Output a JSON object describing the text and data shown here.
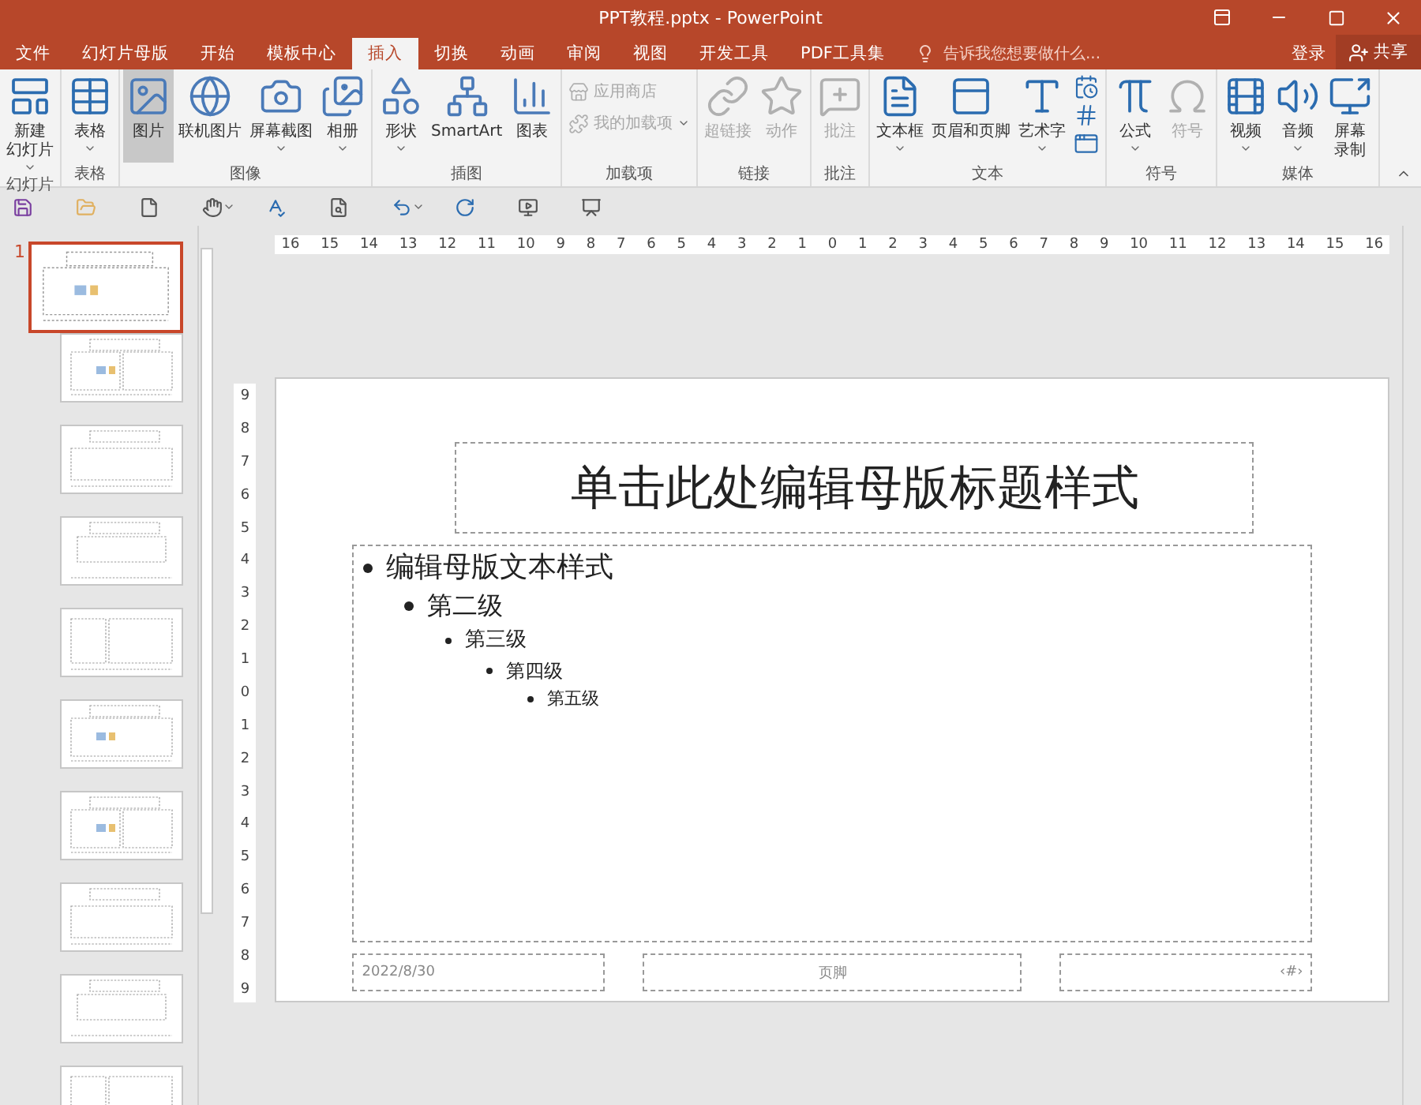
{
  "window": {
    "title": "PPT教程.pptx - PowerPoint"
  },
  "tabs": [
    {
      "label": "文件",
      "selected": false
    },
    {
      "label": "幻灯片母版",
      "selected": false
    },
    {
      "label": "开始",
      "selected": false
    },
    {
      "label": "模板中心",
      "selected": false
    },
    {
      "label": "插入",
      "selected": true
    },
    {
      "label": "切换",
      "selected": false
    },
    {
      "label": "动画",
      "selected": false
    },
    {
      "label": "审阅",
      "selected": false
    },
    {
      "label": "视图",
      "selected": false
    },
    {
      "label": "开发工具",
      "selected": false
    },
    {
      "label": "PDF工具集",
      "selected": false
    }
  ],
  "tell_me": {
    "placeholder": "告诉我您想要做什么..."
  },
  "account": {
    "login": "登录",
    "share": "共享"
  },
  "ribbon": {
    "groups": [
      {
        "label": "幻灯片",
        "items": [
          {
            "kind": "large",
            "label": [
              "新建",
              "幻灯片"
            ],
            "dropdown": true,
            "disabled": false,
            "highlighted": false
          }
        ]
      },
      {
        "label": "表格",
        "items": [
          {
            "kind": "large",
            "label": "表格",
            "dropdown": true,
            "disabled": false,
            "highlighted": false
          }
        ]
      },
      {
        "label": "图像",
        "items": [
          {
            "kind": "large",
            "label": "图片",
            "dropdown": false,
            "disabled": false,
            "highlighted": true
          },
          {
            "kind": "large",
            "label": "联机图片",
            "dropdown": false,
            "disabled": false,
            "highlighted": false
          },
          {
            "kind": "large",
            "label": "屏幕截图",
            "dropdown": true,
            "disabled": false,
            "highlighted": false
          },
          {
            "kind": "large",
            "label": "相册",
            "dropdown": true,
            "disabled": false,
            "highlighted": false
          }
        ]
      },
      {
        "label": "插图",
        "items": [
          {
            "kind": "large",
            "label": "形状",
            "dropdown": true,
            "disabled": false,
            "highlighted": false
          },
          {
            "kind": "large",
            "label": "SmartArt",
            "dropdown": false,
            "disabled": false,
            "highlighted": false
          },
          {
            "kind": "large",
            "label": "图表",
            "dropdown": false,
            "disabled": false,
            "highlighted": false
          }
        ]
      },
      {
        "label": "加载项",
        "items": [
          {
            "kind": "small",
            "label": "应用商店",
            "dropdown": false,
            "disabled": true,
            "highlighted": false
          },
          {
            "kind": "small",
            "label": "我的加载项",
            "dropdown": true,
            "disabled": true,
            "highlighted": false
          }
        ]
      },
      {
        "label": "链接",
        "items": [
          {
            "kind": "large",
            "label": "超链接",
            "dropdown": false,
            "disabled": true,
            "highlighted": false
          },
          {
            "kind": "large",
            "label": "动作",
            "dropdown": false,
            "disabled": true,
            "highlighted": false
          }
        ]
      },
      {
        "label": "批注",
        "items": [
          {
            "kind": "large",
            "label": "批注",
            "dropdown": false,
            "disabled": true,
            "highlighted": false
          }
        ]
      },
      {
        "label": "文本",
        "items": [
          {
            "kind": "large",
            "label": "文本框",
            "dropdown": true,
            "disabled": false,
            "highlighted": false
          },
          {
            "kind": "large",
            "label": "页眉和页脚",
            "dropdown": false,
            "disabled": false,
            "highlighted": false
          },
          {
            "kind": "large",
            "label": "艺术字",
            "dropdown": true,
            "disabled": false,
            "highlighted": false
          },
          {
            "kind": "icon",
            "dropdown": false,
            "disabled": false,
            "highlighted": false
          },
          {
            "kind": "icon",
            "dropdown": false,
            "disabled": false,
            "highlighted": false
          },
          {
            "kind": "icon",
            "dropdown": false,
            "disabled": false,
            "highlighted": false
          }
        ]
      },
      {
        "label": "符号",
        "items": [
          {
            "kind": "large",
            "label": "公式",
            "dropdown": true,
            "disabled": false,
            "highlighted": false
          },
          {
            "kind": "large",
            "label": "符号",
            "dropdown": false,
            "disabled": true,
            "highlighted": false
          }
        ]
      },
      {
        "label": "媒体",
        "items": [
          {
            "kind": "large",
            "label": "视频",
            "dropdown": true,
            "disabled": false,
            "highlighted": false
          },
          {
            "kind": "large",
            "label": "音频",
            "dropdown": true,
            "disabled": false,
            "highlighted": false
          },
          {
            "kind": "large",
            "label": [
              "屏幕",
              "录制"
            ],
            "dropdown": false,
            "disabled": false,
            "highlighted": false
          }
        ]
      }
    ]
  },
  "rulers": {
    "horizontal": [
      "16",
      "15",
      "14",
      "13",
      "12",
      "11",
      "10",
      "9",
      "8",
      "7",
      "6",
      "5",
      "4",
      "3",
      "2",
      "1",
      "0",
      "1",
      "2",
      "3",
      "4",
      "5",
      "6",
      "7",
      "8",
      "9",
      "10",
      "11",
      "12",
      "13",
      "14",
      "15",
      "16"
    ],
    "vertical": [
      "9",
      "8",
      "7",
      "6",
      "5",
      "4",
      "3",
      "2",
      "1",
      "0",
      "1",
      "2",
      "3",
      "4",
      "5",
      "6",
      "7",
      "8",
      "9"
    ]
  },
  "slides": [
    {
      "number": "1",
      "selected": true
    },
    {
      "selected": false
    },
    {
      "selected": false
    },
    {
      "selected": false
    },
    {
      "selected": false
    },
    {
      "selected": false
    },
    {
      "selected": false
    },
    {
      "selected": false
    },
    {
      "selected": false
    },
    {
      "selected": false
    }
  ],
  "master": {
    "title": "单击此处编辑母版标题样式",
    "body": [
      {
        "text": "编辑母版文本样式",
        "children": [
          {
            "text": "第二级",
            "children": [
              {
                "text": "第三级",
                "children": [
                  {
                    "text": "第四级",
                    "children": [
                      {
                        "text": "第五级"
                      }
                    ]
                  }
                ]
              }
            ]
          }
        ]
      }
    ],
    "footer": {
      "date": "2022/8/30",
      "text": "页脚",
      "number": "‹#›"
    }
  }
}
